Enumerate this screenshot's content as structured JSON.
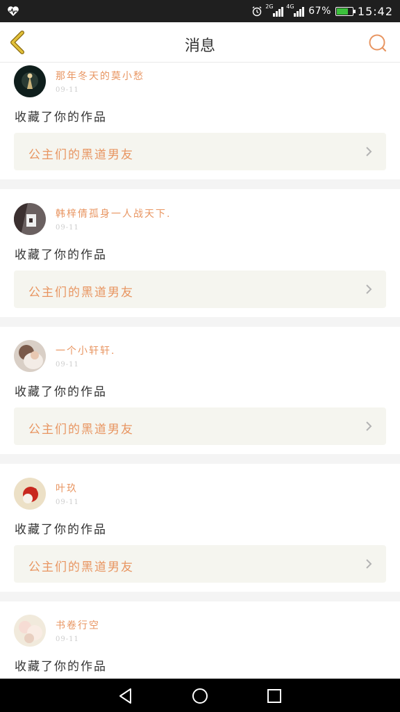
{
  "status_bar": {
    "left_icon": "heart-monitor-icon",
    "alarm_icon": "alarm-icon",
    "signal1_tag": "2G",
    "signal2_tag": "4G",
    "battery_percent": "67%",
    "battery_level": 0.67,
    "time": "15:42"
  },
  "header": {
    "title": "消息",
    "back_icon": "chevron-left-icon",
    "search_icon": "search-icon",
    "accent_color": "#e89561"
  },
  "notifications": [
    {
      "username": "那年冬天的莫小愁",
      "date": "09-11",
      "action": "收藏了你的作品",
      "work_title": "公主们的黑道男友"
    },
    {
      "username": "韩梓倩孤身一人战天下.",
      "date": "09-11",
      "action": "收藏了你的作品",
      "work_title": "公主们的黑道男友"
    },
    {
      "username": "一个小轩轩.",
      "date": "09-11",
      "action": "收藏了你的作品",
      "work_title": "公主们的黑道男友"
    },
    {
      "username": "叶玖",
      "date": "09-11",
      "action": "收藏了你的作品",
      "work_title": "公主们的黑道男友"
    },
    {
      "username": "书卷行空",
      "date": "09-11",
      "action": "收藏了你的作品",
      "work_title": ""
    }
  ],
  "nav_bar": {
    "back_icon": "triangle-back-icon",
    "home_icon": "circle-home-icon",
    "recents_icon": "square-recents-icon"
  }
}
